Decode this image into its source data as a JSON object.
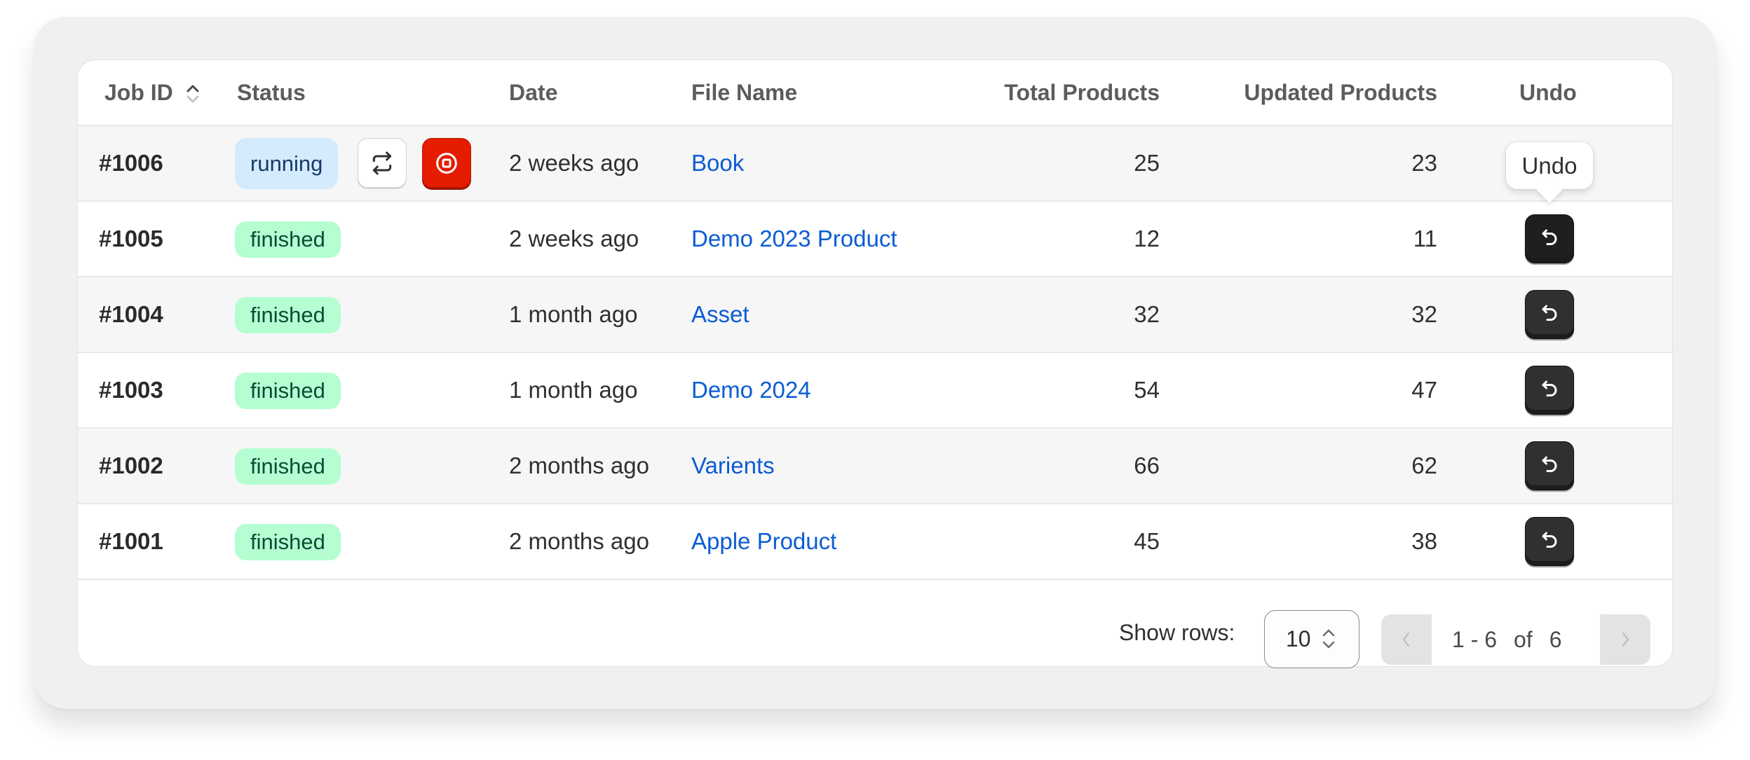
{
  "table": {
    "columns": {
      "job_id": "Job ID",
      "status": "Status",
      "date": "Date",
      "file_name": "File Name",
      "total_products": "Total Products",
      "updated_products": "Updated Products",
      "undo": "Undo"
    },
    "sort": {
      "column": "Job ID",
      "direction": "ascending"
    },
    "rows": [
      {
        "job_id": "#1006",
        "status": "running",
        "date": "2 weeks ago",
        "file_name": "Book",
        "total_products": "25",
        "updated_products": "23",
        "actions": [
          "refresh-icon",
          "stop-icon"
        ]
      },
      {
        "job_id": "#1005",
        "status": "finished",
        "date": "2 weeks ago",
        "file_name": "Demo 2023 Product",
        "total_products": "12",
        "updated_products": "11",
        "undo_icon": "undo-icon"
      },
      {
        "job_id": "#1004",
        "status": "finished",
        "date": "1 month ago",
        "file_name": "Asset",
        "total_products": "32",
        "updated_products": "32",
        "undo_icon": "undo-icon"
      },
      {
        "job_id": "#1003",
        "status": "finished",
        "date": "1 month ago",
        "file_name": "Demo 2024",
        "total_products": "54",
        "updated_products": "47",
        "undo_icon": "undo-icon"
      },
      {
        "job_id": "#1002",
        "status": "finished",
        "date": "2 months ago",
        "file_name": "Varients",
        "total_products": "66",
        "updated_products": "62",
        "undo_icon": "undo-icon"
      },
      {
        "job_id": "#1001",
        "status": "finished",
        "date": "2 months ago",
        "file_name": "Apple Product",
        "total_products": "45",
        "updated_products": "38",
        "undo_icon": "undo-icon"
      }
    ]
  },
  "tooltip": {
    "text": "Undo"
  },
  "footer": {
    "show_rows_label": "Show rows:",
    "rows_per_page": "10",
    "range": "1 - 6",
    "of_label": "of",
    "total": "6",
    "prev_icon": "chevron-left-icon",
    "next_icon": "chevron-right-icon"
  },
  "colors": {
    "running_badge_bg": "#d4ebfe",
    "finished_badge_bg": "#b4fed2",
    "link": "#0b5cd5",
    "stop_button": "#e51c00",
    "undo_button": "#303030"
  }
}
